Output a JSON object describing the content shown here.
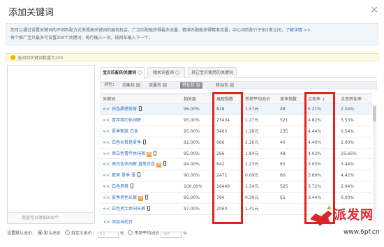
{
  "dialog": {
    "title": "添加关键词",
    "notice": "您可以通过设置关键词的不同匹配方式来提高关键词的展现机会，广泛匹配能获得最多流量，精准匹配能获得精准流量，中心词匹配介于前2者之间，",
    "notice_link": "了解详情 >>",
    "notice_line2": "每个推广宝贝最多可设置200个关键词，每行输入一词，按回车输入下一个。",
    "warning": "选词到关键词数量为200"
  },
  "left_panel": {
    "counter": "您还可以添加200个"
  },
  "tabs": [
    {
      "label": "宝贝匹配的关键词",
      "active": true
    },
    {
      "label": "相关词查询",
      "active": false
    },
    {
      "label": "其它宝贝使用的关键词",
      "active": false
    }
  ],
  "filters": {
    "prefix": "词包：",
    "options": [
      {
        "label": "均衡包",
        "on": false
      },
      {
        "label": "流量包",
        "on": false
      },
      {
        "label": "转化包",
        "on": true
      },
      {
        "label": "移动包",
        "on": false
      }
    ]
  },
  "table": {
    "headers": [
      "关键词",
      "相关度",
      "展现指数",
      "市场平均出价",
      "竞争指数",
      "点击率",
      "点击转化率"
    ],
    "sort_marker": "↓",
    "rows": [
      {
        "kw": "白色质感修身",
        "mob": true,
        "tag": false,
        "rel": "96.00%",
        "imp": "818",
        "bid": "1.57元",
        "comp": "48",
        "ctr": "5.21%",
        "cvr": "2.04%"
      },
      {
        "kw": "青年简约休闲裤",
        "mob": false,
        "tag": false,
        "rel": "95.00%",
        "imp": "23434",
        "bid": "1.27元",
        "comp": "521",
        "ctr": "4.82%",
        "cvr": "3.53%"
      },
      {
        "kw": "夏季新款 白色",
        "mob": false,
        "tag": false,
        "rel": "95.00%",
        "imp": "3463",
        "bid": "1.28元",
        "comp": "235",
        "ctr": "4.44%",
        "cvr": "0.54%"
      },
      {
        "kw": "白色长裤男夏季",
        "mob": true,
        "tag": false,
        "rel": "92.00%",
        "imp": "986",
        "bid": "2.26元",
        "comp": "40",
        "ctr": "4.40%",
        "cvr": "2.00%"
      },
      {
        "kw": "男白色青年休闲裤",
        "mob": true,
        "tag": true,
        "rel": "95.00%",
        "imp": "266",
        "bid": "1.84元",
        "comp": "48",
        "ctr": "4.02%",
        "cvr": "16.66%"
      },
      {
        "kw": "男白色休闲裤 直筒白色",
        "mob": true,
        "tag": true,
        "rel": "94.00%",
        "imp": "642",
        "bid": "1.23元",
        "comp": "65",
        "ctr": "3.95%",
        "cvr": "3.44%"
      },
      {
        "kw": "裤男 夏季 薄",
        "mob": true,
        "tag": false,
        "rel": "90.00%",
        "imp": "2472",
        "bid": "0.69元",
        "comp": "60",
        "ctr": "3.89%",
        "cvr": "4.42%"
      },
      {
        "kw": "白色男裤",
        "mob": true,
        "tag": false,
        "rel": "100.00%",
        "imp": "16449",
        "bid": "1.34元",
        "comp": "525",
        "ctr": "3.72%",
        "cvr": "2.94%"
      },
      {
        "kw": "夏季男色长裤",
        "mob": true,
        "tag": true,
        "rel": "95.00%",
        "imp": "784",
        "bid": "0.30元",
        "comp": "65",
        "ctr": "3.44%",
        "cvr": "0.00%"
      },
      {
        "kw": "白色男士休闲长裤",
        "mob": true,
        "tag": false,
        "rel": "97.00%",
        "imp": "2060",
        "bid": "1.41元",
        "comp": "",
        "ctr": "",
        "cvr": ""
      }
    ]
  },
  "add_link": "添加当前页",
  "bottom": {
    "label": "设置默认出价：",
    "opt1": "默认出价",
    "opt2": "自定义出价：",
    "unit": "元",
    "opt3": "市场平均出价",
    "percent": "%",
    "input1_placeholder": "0.1",
    "input2_placeholder": "100"
  },
  "watermark": {
    "brand": "派发网",
    "site": "www.6pf.cn"
  },
  "colors": {
    "highlight_box": "#e2231a",
    "link": "#2f6fbf"
  }
}
